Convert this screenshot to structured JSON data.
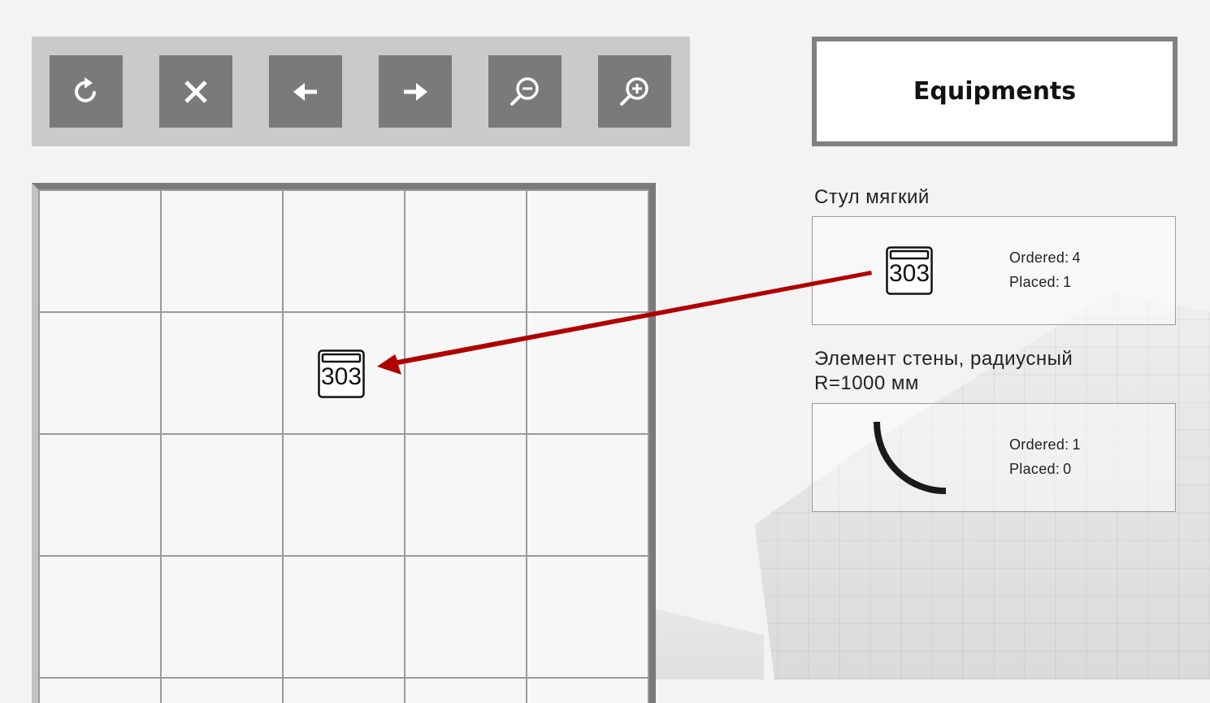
{
  "toolbar": {
    "buttons": [
      {
        "icon": "refresh-icon"
      },
      {
        "icon": "close-icon"
      },
      {
        "icon": "arrow-left-icon"
      },
      {
        "icon": "arrow-right-icon"
      },
      {
        "icon": "zoom-out-icon"
      },
      {
        "icon": "zoom-in-icon"
      }
    ],
    "background": "#cacaca",
    "button_color": "#7a7a7a"
  },
  "equipment_panel": {
    "title": "Equipments",
    "items": [
      {
        "name": "Стул мягкий",
        "icon": "chair-303-icon",
        "icon_text": "303",
        "ordered_label": "Ordered:",
        "ordered": "4",
        "placed_label": "Placed:",
        "placed": "1"
      },
      {
        "name": "Элемент стены, радиусный",
        "name_line2": "R=1000 мм",
        "icon": "curved-wall-icon",
        "ordered_label": "Ordered:",
        "ordered": "1",
        "placed_label": "Placed:",
        "placed": "0"
      }
    ]
  },
  "floor_plan": {
    "placed_item_icon": "chair-303-icon",
    "placed_item_text": "303"
  },
  "drag_arrow_color": "#b00000"
}
